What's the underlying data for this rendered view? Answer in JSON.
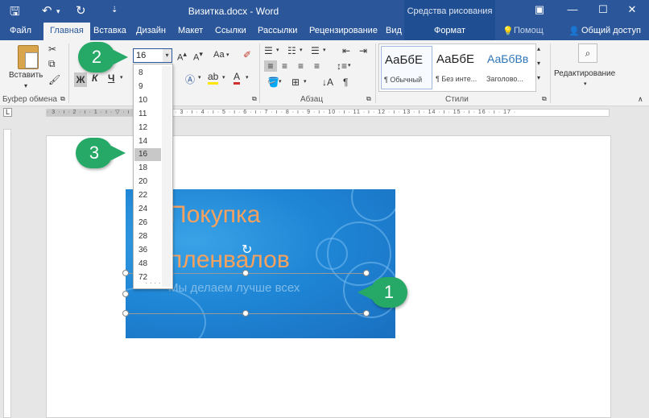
{
  "titlebar": {
    "title": "Визитка.docx - Word",
    "context_title": "Средства рисования"
  },
  "tabs": [
    "Файл",
    "Главная",
    "Вставка",
    "Дизайн",
    "Макет",
    "Ссылки",
    "Рассылки",
    "Рецензирование",
    "Вид",
    "Формат"
  ],
  "help": "Помощ",
  "share": "Общий доступ",
  "ribbon": {
    "paste": "Вставить",
    "clipboard_group": "Буфер обмена",
    "font_size_value": "16",
    "bold": "Ж",
    "italic": "К",
    "underline": "Ч",
    "case": "Аа",
    "paragraph_group": "Абзац",
    "styles_group": "Стили",
    "editing": "Редактирование",
    "styles": [
      {
        "sample": "АаБбЕ",
        "name": "¶ Обычный"
      },
      {
        "sample": "АаБбЕ",
        "name": "¶ Без инте..."
      },
      {
        "sample": "АаБбВв",
        "name": "Заголово..."
      }
    ]
  },
  "ruler_text": "· 3 · ı · 2 · ı · 1 · ı · ▽ · ı · 1 · ı · 2 · ı · 3 · ı · 4 · ı · 5 · ı · 6 · ı · 7 · ı · 8 · ı · 9 · ı · 10 · ı · 11 · ı · 12 · ı · 13 · ı · 14 · ı · 15 · ı · 16 · ı · 17 ·",
  "font_sizes": [
    "8",
    "9",
    "10",
    "11",
    "12",
    "14",
    "16",
    "18",
    "20",
    "22",
    "24",
    "26",
    "28",
    "36",
    "48",
    "72"
  ],
  "selected_size": "16",
  "card": {
    "line1": "Покупка",
    "line2": "пленвалов",
    "subtitle": "Мы делаем лучше всех"
  },
  "callouts": [
    "1",
    "2",
    "3"
  ]
}
